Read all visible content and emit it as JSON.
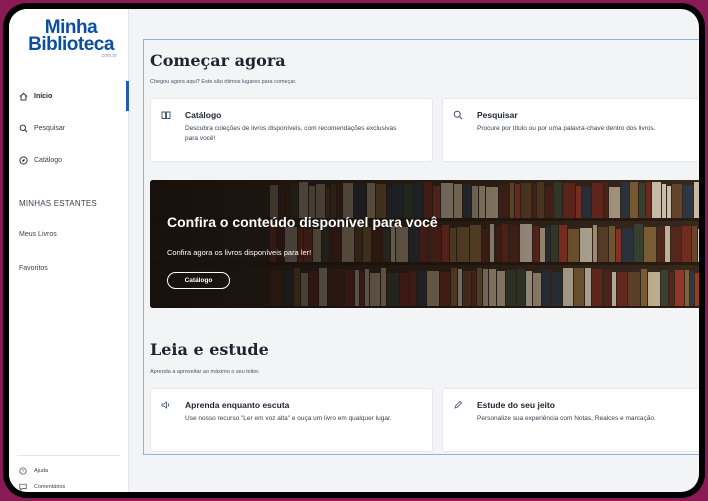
{
  "logo": {
    "line1": "Minha",
    "line2": "Biblioteca",
    "domain": ".com.br"
  },
  "sidebar": {
    "nav": [
      {
        "label": "Início",
        "icon": "home-icon",
        "active": true
      },
      {
        "label": "Pesquisar",
        "icon": "search-icon",
        "active": false
      },
      {
        "label": "Catálogo",
        "icon": "compass-icon",
        "active": false
      }
    ],
    "section_heading": "MINHAS ESTANTES",
    "links": [
      "Meus Livros",
      "Favoritos"
    ],
    "footer": [
      {
        "label": "Ajuda",
        "icon": "help-icon"
      },
      {
        "label": "Comentários",
        "icon": "comment-icon"
      }
    ]
  },
  "start": {
    "title": "Começar agora",
    "subtitle": "Chegou agora aqui? Este são ótimos lugares para começar.",
    "cards": [
      {
        "title": "Catálogo",
        "desc": "Descubra coleções de livros disponíveis, com recomendações exclusivas para você!",
        "icon": "book-icon"
      },
      {
        "title": "Pesquisar",
        "desc": "Procure por título ou por uma palavra-chave dentro dos livros.",
        "icon": "search-icon"
      }
    ]
  },
  "banner": {
    "title": "Confira o conteúdo disponível para você",
    "subtitle": "Confira agora os livros disponíveis para ler!",
    "button": "Catálogo"
  },
  "study": {
    "title": "Leia e estude",
    "subtitle": "Aprenda a aproveitar ao máximo o seu leitor.",
    "cards": [
      {
        "title": "Aprenda enquanto escuta",
        "desc": "Use nosso recurso \"Ler em voz alta\" e ouça um livro em qualquer lugar.",
        "icon": "speaker-icon"
      },
      {
        "title": "Estude do seu jeito",
        "desc": "Personalize sua experiência com Notas, Realces e marcação.",
        "icon": "pencil-icon"
      }
    ]
  },
  "colors": {
    "brand": "#0b4fa0",
    "accent": "#1e5fb4",
    "frame": "#8a1a56"
  }
}
